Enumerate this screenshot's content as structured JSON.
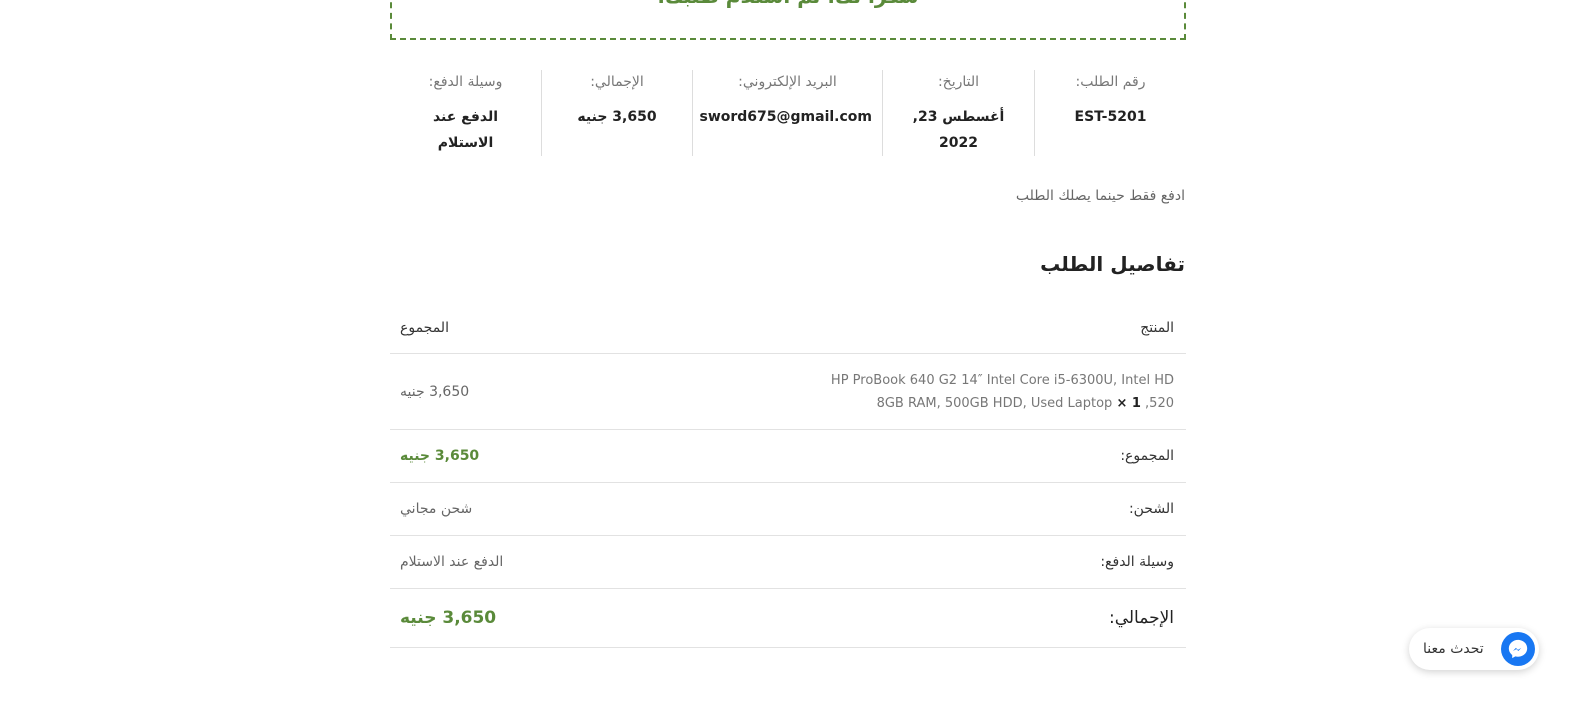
{
  "thanks": {
    "message": "شكراً لك. تم استلام طلبك."
  },
  "overview": {
    "order_number": {
      "label": "رقم الطلب:",
      "value": "EST-5201"
    },
    "date": {
      "label": "التاريخ:",
      "value_line1": "أغسطس 23,",
      "value_line2": "2022"
    },
    "email": {
      "label": "البريد الإلكتروني:",
      "value": "sword675@gmail.com"
    },
    "total": {
      "label": "الإجمالي:",
      "value": "3,650 جنيه"
    },
    "payment": {
      "label": "وسيلة الدفع:",
      "value_line1": "الدفع عند",
      "value_line2": "الاستلام"
    }
  },
  "payment_note": "ادفع فقط حينما يصلك الطلب",
  "details": {
    "title": "تفاصيل الطلب",
    "header": {
      "product": "المنتج",
      "total": "المجموع"
    },
    "items": [
      {
        "name_line1": "HP ProBook 640 G2 14″ Intel Core i5-6300U, Intel HD",
        "name_line2": "520, 8GB RAM, 500GB HDD, Used Laptop",
        "qty": "× 1",
        "total": "3,650 جنيه"
      }
    ],
    "subtotal": {
      "label": "المجموع:",
      "value": "3,650 جنيه"
    },
    "shipping": {
      "label": "الشحن:",
      "value": "شحن مجاني"
    },
    "payment_method": {
      "label": "وسيلة الدفع:",
      "value": "الدفع عند الاستلام"
    },
    "grand_total": {
      "label": "الإجمالي:",
      "value": "3,650 جنيه"
    }
  },
  "chat": {
    "label": "تحدث معنا",
    "icon": "messenger-icon"
  },
  "colors": {
    "accent_green": "#5a8a3a",
    "messenger_blue": "#1877f2"
  }
}
